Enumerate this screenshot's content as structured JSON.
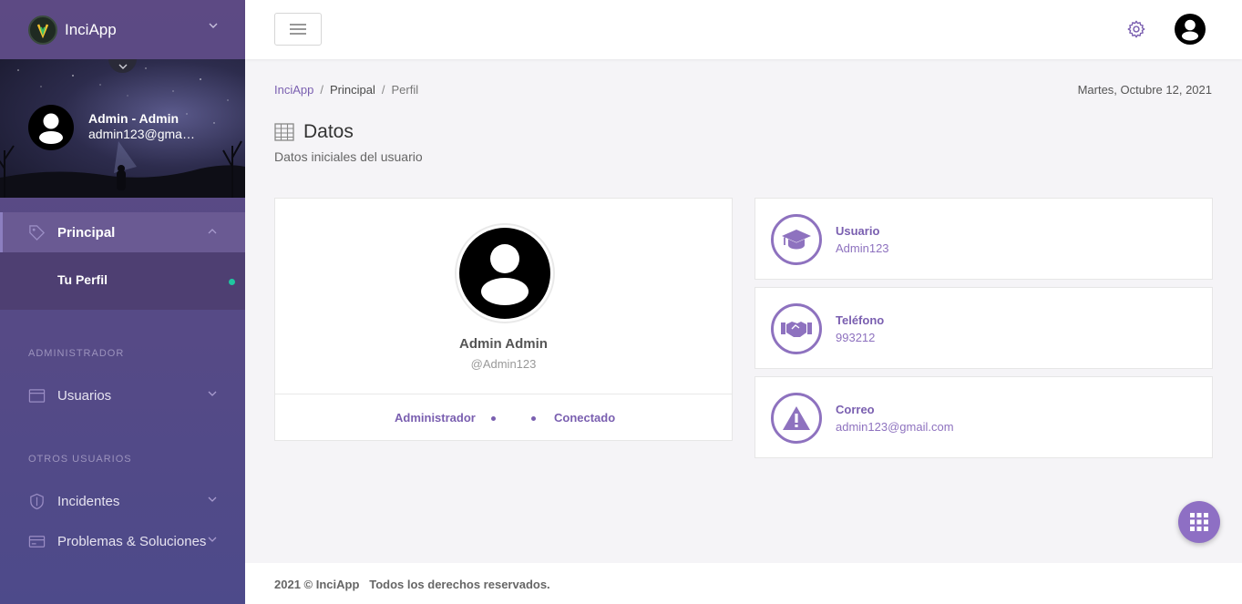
{
  "app": {
    "name": "InciApp"
  },
  "sidebar": {
    "user_name": "Admin - Admin",
    "user_email": "admin123@gmail.com",
    "menu": {
      "principal": "Principal",
      "tu_perfil": "Tu Perfil",
      "section_admin": "ADMINISTRADOR",
      "usuarios": "Usuarios",
      "section_otros": "OTROS USUARIOS",
      "incidentes": "Incidentes",
      "problemas": "Problemas & Soluciones"
    }
  },
  "breadcrumb": {
    "root": "InciApp",
    "level1": "Principal",
    "current": "Perfil"
  },
  "date": "Martes, Octubre 12, 2021",
  "page": {
    "title": "Datos",
    "subtitle": "Datos iniciales del usuario"
  },
  "profile_card": {
    "name": "Admin Admin",
    "username": "@Admin123",
    "role": "Administrador",
    "status": "Conectado"
  },
  "info": [
    {
      "label": "Usuario",
      "value": "Admin123",
      "icon": "graduation-cap-icon"
    },
    {
      "label": "Teléfono",
      "value": "993212",
      "icon": "handshake-icon"
    },
    {
      "label": "Correo",
      "value": "admin123@gmail.com",
      "icon": "warning-icon"
    }
  ],
  "footer": {
    "text": "2021 © InciApp   Todos los derechos reservados."
  },
  "colors": {
    "accent": "#7a5fb0",
    "sidebar": "#5d4a84",
    "status_dot": "#1fc6a0"
  }
}
